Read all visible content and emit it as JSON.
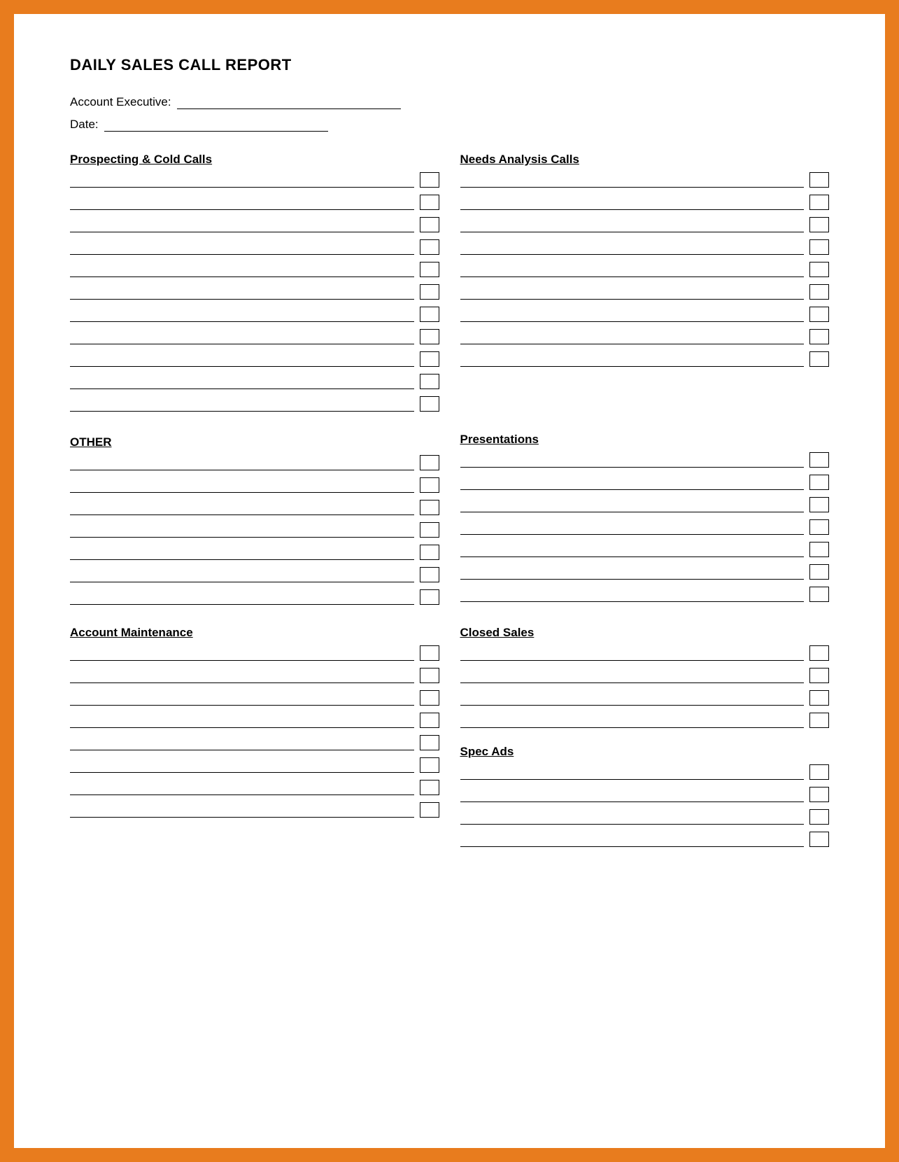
{
  "page": {
    "outer_bg": "#e87c1e",
    "inner_bg": "#ffffff"
  },
  "header": {
    "title": "DAILY SALES CALL REPORT",
    "account_executive_label": "Account Executive:",
    "date_label": "Date:"
  },
  "sections": {
    "prospecting_cold_calls": {
      "title": "Prospecting & Cold Calls",
      "rows": 11
    },
    "needs_analysis_calls": {
      "title": "Needs Analysis Calls",
      "rows": 9
    },
    "other": {
      "title": "OTHER",
      "rows": 7
    },
    "presentations": {
      "title": "Presentations",
      "rows": 7
    },
    "account_maintenance": {
      "title": "Account Maintenance",
      "rows": 8
    },
    "closed_sales": {
      "title": "Closed Sales",
      "rows": 4
    },
    "spec_ads": {
      "title": "Spec Ads",
      "rows": 4
    }
  }
}
